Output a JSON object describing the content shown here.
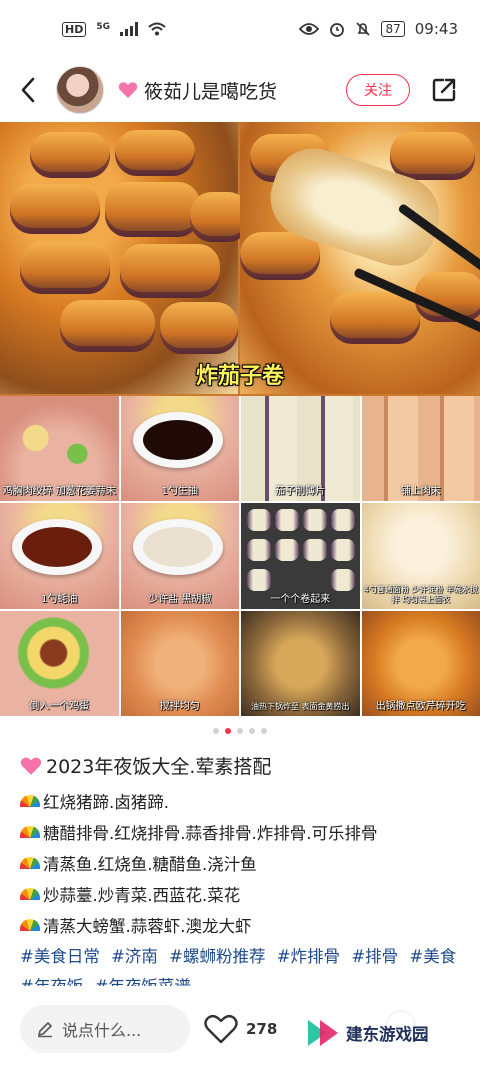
{
  "status_bar": {
    "hd": "HD",
    "network": "5G",
    "battery": "87",
    "time": "09:43"
  },
  "header": {
    "author_name": "筱茹儿是噶吃货",
    "follow_label": "关注"
  },
  "media": {
    "hero_title": "炸茄子卷",
    "steps": [
      "鸡胸肉绞碎 加葱花姜蒜末",
      "1勺生抽",
      "茄子削薄片",
      "铺上肉末",
      "1勺蚝油",
      "少许盐 黑胡椒",
      "一个个卷起来",
      "4勺普通面粉 少许淀粉 半碗水搅拌 均匀裹上面衣",
      "倒入一个鸡蛋",
      "搅拌均匀",
      "油热下锅炸至 表面金黄捞出",
      "出锅撒点欧芹碎开吃"
    ],
    "page_count": 5,
    "active_page": 2
  },
  "post": {
    "title": "2023年夜饭大全.荤素搭配",
    "lines": [
      "红烧猪蹄.卤猪蹄.",
      "糖醋排骨.红烧排骨.蒜香排骨.炸排骨.可乐排骨",
      "清蒸鱼.红烧鱼.糖醋鱼.浇汁鱼",
      "炒蒜薹.炒青菜.西蓝花.菜花",
      "清蒸大螃蟹.蒜蓉虾.澳龙大虾"
    ],
    "tags": [
      "#美食日常",
      "#济南",
      "#螺蛳粉推荐",
      "#炸排骨",
      "#排骨",
      "#美食",
      "#年夜饭",
      "#年夜饭菜谱"
    ]
  },
  "bottom_bar": {
    "comment_placeholder": "说点什么...",
    "like_count": "278"
  },
  "watermark": {
    "text": "建东游戏园"
  },
  "colors": {
    "accent": "#ff2e4d",
    "tag": "#1f4b8c"
  }
}
